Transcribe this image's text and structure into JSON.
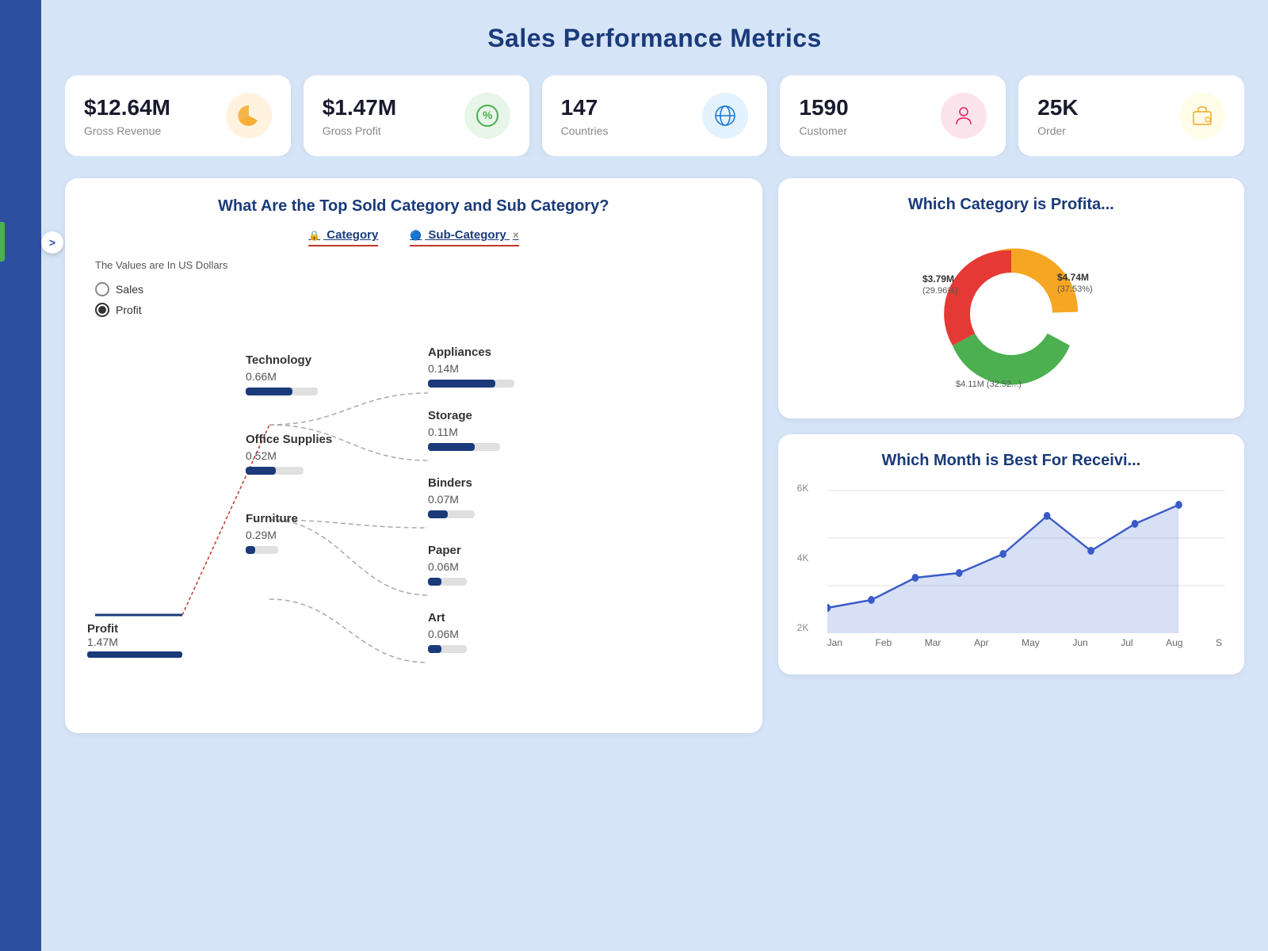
{
  "page": {
    "title": "Sales Performance Metrics"
  },
  "sidebar": {
    "arrow_label": ">"
  },
  "kpi_cards": [
    {
      "value": "$12.64M",
      "label": "Gross Revenue",
      "icon_name": "pie-chart-icon",
      "icon_symbol": "📊",
      "icon_class": "orange"
    },
    {
      "value": "$1.47M",
      "label": "Gross Profit",
      "icon_name": "percent-icon",
      "icon_symbol": "%",
      "icon_class": "green"
    },
    {
      "value": "147",
      "label": "Countries",
      "icon_name": "globe-icon",
      "icon_symbol": "🌐",
      "icon_class": "blue"
    },
    {
      "value": "1590",
      "label": "Customer",
      "icon_name": "customer-icon",
      "icon_symbol": "👤",
      "icon_class": "pink"
    },
    {
      "value": "25K",
      "label": "Order",
      "icon_name": "order-icon",
      "icon_symbol": "🛒",
      "icon_class": "yellow"
    }
  ],
  "top_category_chart": {
    "title": "What Are the Top Sold Category and Sub Category?",
    "tab_category": "Category",
    "tab_subcategory": "Sub-Category",
    "note": "The Values are In US Dollars",
    "radio_sales": "Sales",
    "radio_profit": "Profit",
    "categories": [
      {
        "name": "Profit",
        "value": "1.47M",
        "bar_pct": 100
      },
      {
        "name": "Technology",
        "value": "0.66M",
        "bar_pct": 65
      },
      {
        "name": "Office Supplies",
        "value": "0.52M",
        "bar_pct": 52
      },
      {
        "name": "Furniture",
        "value": "0.29M",
        "bar_pct": 29
      }
    ],
    "subcategories": [
      {
        "name": "Appliances",
        "value": "0.14M",
        "bar_pct": 78
      },
      {
        "name": "Storage",
        "value": "0.11M",
        "bar_pct": 65
      },
      {
        "name": "Binders",
        "value": "0.07M",
        "bar_pct": 42
      },
      {
        "name": "Paper",
        "value": "0.06M",
        "bar_pct": 35
      },
      {
        "name": "Art",
        "value": "0.06M",
        "bar_pct": 35
      }
    ]
  },
  "donut_chart": {
    "title": "Which Category is Profita...",
    "segments": [
      {
        "label": "$4.74M\n(37.53%)",
        "color": "#f5a623",
        "percent": 37.53
      },
      {
        "label": "$4.11M (32.52...)",
        "color": "#4caf50",
        "percent": 32.52
      },
      {
        "label": "$3.79M\n(29.96%)",
        "color": "#e53935",
        "percent": 29.96
      }
    ]
  },
  "line_chart": {
    "title": "Which Month is Best For Receivi...",
    "y_labels": [
      "6K",
      "4K",
      "2K"
    ],
    "x_labels": [
      "Jan",
      "Feb",
      "Mar",
      "Apr",
      "May",
      "Jun",
      "Jul",
      "Aug",
      "S"
    ],
    "data_points": [
      {
        "month": "Jan",
        "value": 2200
      },
      {
        "month": "Feb",
        "value": 2600
      },
      {
        "month": "Mar",
        "value": 3200
      },
      {
        "month": "Apr",
        "value": 3400
      },
      {
        "month": "May",
        "value": 4200
      },
      {
        "month": "Jun",
        "value": 5600
      },
      {
        "month": "Jul",
        "value": 4300
      },
      {
        "month": "Aug",
        "value": 5200
      },
      {
        "month": "Sep",
        "value": 5800
      }
    ]
  }
}
